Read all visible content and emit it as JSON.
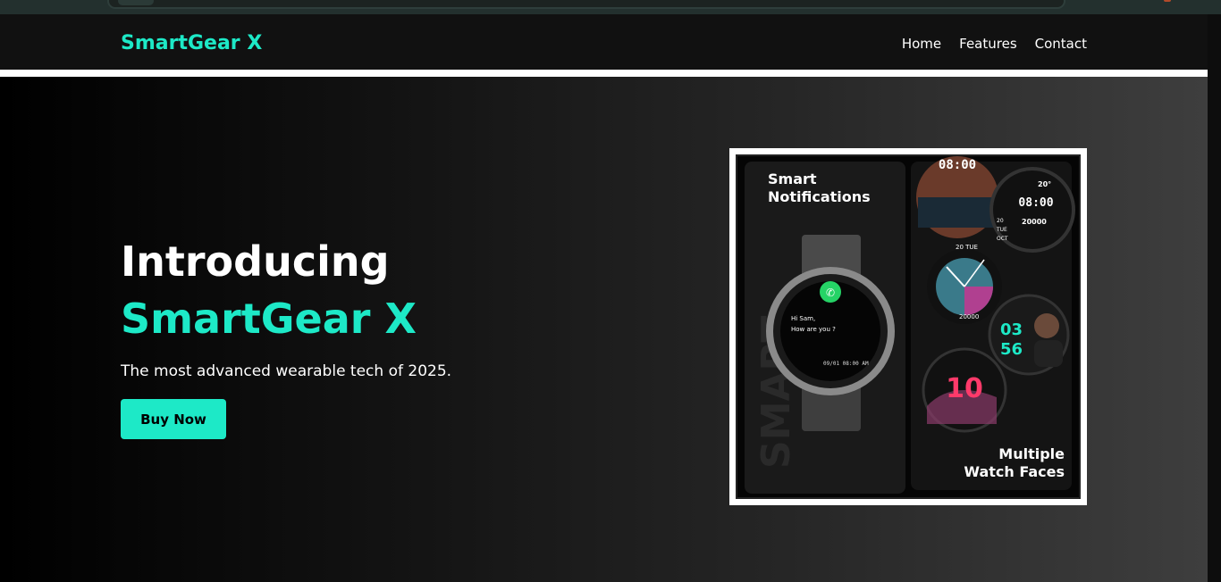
{
  "nav": {
    "brand": "SmartGear X",
    "links": [
      "Home",
      "Features",
      "Contact"
    ]
  },
  "hero": {
    "title_line1": "Introducing",
    "title_line2": "SmartGear X",
    "subtitle": "The most advanced wearable tech of 2025.",
    "cta_label": "Buy Now"
  },
  "product_image": {
    "left_heading_1": "Smart",
    "left_heading_2": "Notifications",
    "right_heading_1": "Multiple",
    "right_heading_2": "Watch Faces",
    "watch_message_1": "Hi Sam,",
    "watch_message_2": "How are you ?",
    "watch_timestamp": "09/01 08:00 AM",
    "face1_time": "08:00",
    "face2_time": "08:00",
    "face2_temp": "20°",
    "face2_steps": "20000",
    "face2_day": "TUE",
    "face2_month": "OCT",
    "face2_date": "20",
    "face3_day": "20 TUE",
    "face3_steps": "20000",
    "face4_hour": "03",
    "face4_min": "56",
    "face5_number": "10",
    "side_word": "SMART"
  },
  "colors": {
    "accent": "#1de9c7",
    "nav_bg": "#111111",
    "text": "#ffffff"
  }
}
